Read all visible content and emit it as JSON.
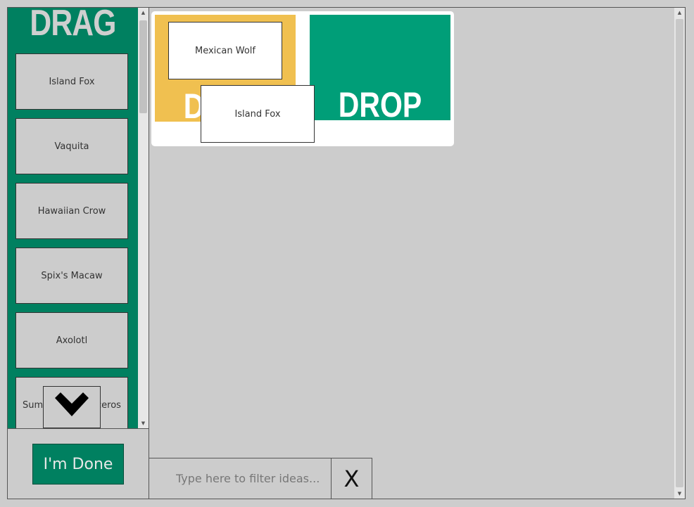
{
  "drag_panel": {
    "title": "DRAG",
    "ideas": [
      {
        "label": "Island Fox"
      },
      {
        "label": "Vaquita"
      },
      {
        "label": "Hawaiian Crow"
      },
      {
        "label": "Spix's Macaw"
      },
      {
        "label": "Axolotl"
      },
      {
        "label": "Sumatran Rhinoceros"
      }
    ],
    "scroll_down_icon": "chevron-down-icon"
  },
  "done_button": {
    "label": "I'm Done"
  },
  "board": {
    "drop_label": "DROP",
    "placed_cards": [
      {
        "label": "Mexican Wolf"
      },
      {
        "label": "Island Fox"
      }
    ]
  },
  "filter": {
    "placeholder": "Type here to filter ideas...",
    "value": ""
  },
  "clear_button": {
    "label": "X"
  },
  "colors": {
    "drag_panel_bg": "#008060",
    "yellow_target": "#f0c050",
    "green_target": "#009e78",
    "app_bg": "#cccccc"
  }
}
